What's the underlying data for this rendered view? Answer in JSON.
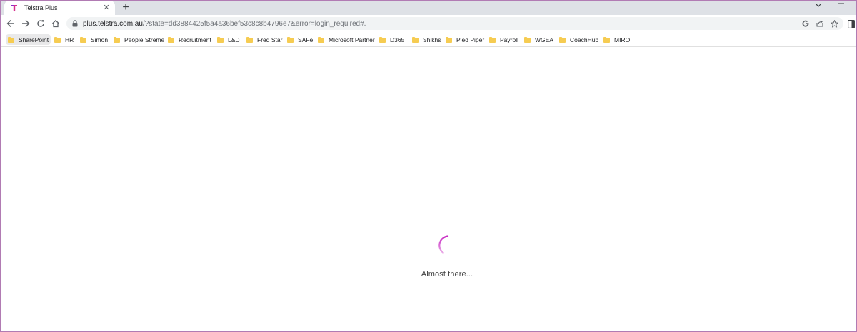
{
  "browser": {
    "tab": {
      "title": "Telstra Plus"
    },
    "address": {
      "host": "plus.telstra.com.au",
      "path": "/?state=dd3884425f5a4a36bef53c8c8b4796e7&error=login_required#."
    },
    "bookmarks": [
      {
        "label": "SharePoint"
      },
      {
        "label": "HR"
      },
      {
        "label": "Simon"
      },
      {
        "label": "People Streme"
      },
      {
        "label": "Recruitment"
      },
      {
        "label": "L&D"
      },
      {
        "label": "Fred Star"
      },
      {
        "label": "SAFe"
      },
      {
        "label": "Microsoft Partner"
      },
      {
        "label": "D365"
      },
      {
        "label": "Shikhs"
      },
      {
        "label": "Pied Piper"
      },
      {
        "label": "Payroll"
      },
      {
        "label": "WGEA"
      },
      {
        "label": "CoachHub"
      },
      {
        "label": "MIRO"
      }
    ]
  },
  "page": {
    "loading_text": "Almost there..."
  },
  "colors": {
    "brand_accent": "#c729c2",
    "folder": "#f6cc52",
    "window_border": "#b17bb3"
  },
  "icons": {
    "tab_favicon": "telstra-logo-icon",
    "back": "arrow-left-icon",
    "forward": "arrow-right-icon",
    "reload": "reload-icon",
    "home": "home-icon",
    "lock": "lock-icon",
    "google": "google-icon",
    "share": "share-icon",
    "bookmark": "star-icon",
    "side_panel": "side-panel-icon",
    "bookmark_folder": "folder-icon"
  }
}
